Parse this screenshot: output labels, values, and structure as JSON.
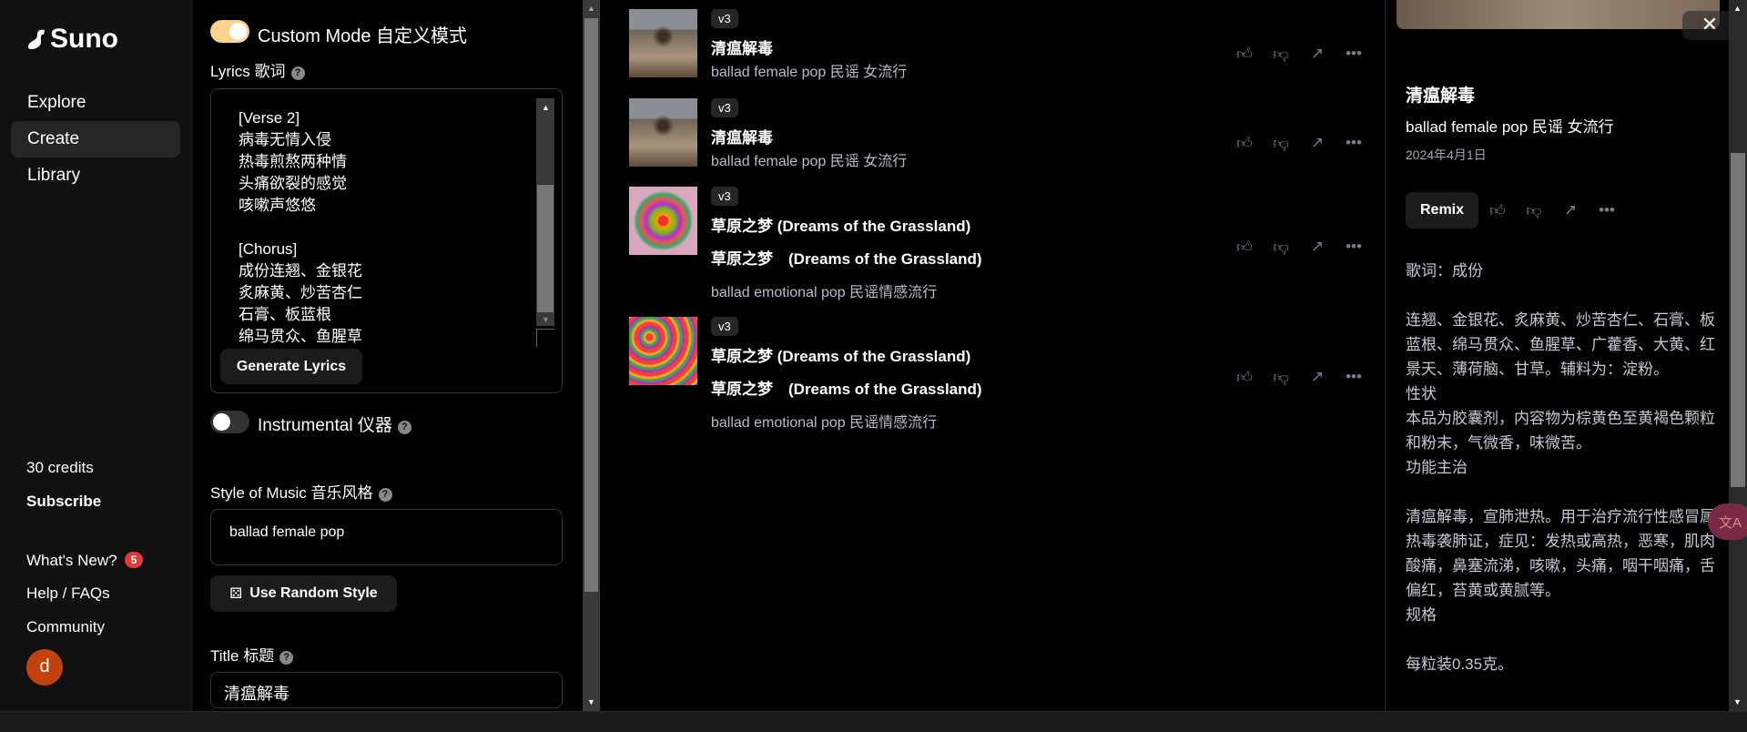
{
  "sidebar": {
    "logo": "Suno",
    "nav": [
      {
        "label": "Explore"
      },
      {
        "label": "Create",
        "active": true
      },
      {
        "label": "Library"
      }
    ],
    "credits": "30 credits",
    "subscribe": "Subscribe",
    "whats_new": "What's New?",
    "whats_new_badge": "5",
    "help": "Help / FAQs",
    "community": "Community",
    "avatar_letter": "d"
  },
  "create": {
    "custom_mode_label": "Custom Mode 自定义模式",
    "custom_mode_on": true,
    "lyrics_label": "Lyrics 歌词",
    "lyrics_lines": [
      "[Verse 2]",
      "病毒无情入侵",
      "热毒煎熬两种情",
      "头痛欲裂的感觉",
      "咳嗽声悠悠",
      "",
      "[Chorus]",
      "成份连翘、金银花",
      "炙麻黄、炒苦杏仁",
      "石膏、板蓝根",
      "绵马贯众、鱼腥草"
    ],
    "generate_lyrics": "Generate Lyrics",
    "instrumental_label": "Instrumental 仪器",
    "instrumental_on": false,
    "style_label": "Style of Music 音乐风格",
    "style_value": "ballad female pop",
    "random_style": "Use Random Style",
    "title_label": "Title 标题",
    "title_value": "清瘟解毒",
    "help_glyph": "?"
  },
  "songs": [
    {
      "version": "v3",
      "title": "清瘟解毒",
      "subtitle": "ballad female pop 民谣 女流行",
      "thumb": "desert-tree"
    },
    {
      "version": "v3",
      "title": "清瘟解毒",
      "subtitle": "ballad female pop 民谣 女流行",
      "thumb": "desert-tree"
    },
    {
      "version": "v3",
      "title": "草原之梦 (Dreams of the Grassland)",
      "title2": "草原之梦　(Dreams of the Grassland)",
      "subtitle": "ballad emotional pop 民谣情感流行",
      "thumb": "flower-ball"
    },
    {
      "version": "v3",
      "title": "草原之梦 (Dreams of the Grassland)",
      "title2": "草原之梦　(Dreams of the Grassland)",
      "subtitle": "ballad emotional pop 民谣情感流行",
      "thumb": "flower-field"
    }
  ],
  "detail": {
    "title": "清瘟解毒",
    "style": "ballad female pop 民谣 女流行",
    "date": "2024年4月1日",
    "remix": "Remix",
    "lyrics": "歌词：成份\n\n连翘、金银花、炙麻黄、炒苦杏仁、石膏、板蓝根、绵马贯众、鱼腥草、广藿香、大黄、红景天、薄荷脑、甘草。辅料为：淀粉。\n性状\n本品为胶囊剂，内容物为棕黄色至黄褐色颗粒和粉末，气微香，味微苦。\n功能主治\n\n清瘟解毒，宣肺泄热。用于治疗流行性感冒属热毒袭肺证，症见：发热或高热，恶寒，肌肉酸痛，鼻塞流涕，咳嗽，头痛，咽干咽痛，舌偏红，苔黄或黄腻等。\n规格\n\n每粒装0.35克。"
  },
  "icons": [
    "like-icon",
    "dislike-icon",
    "share-icon",
    "more-icon",
    "close-icon",
    "dice-icon",
    "translate-icon"
  ],
  "colors": {
    "toggle_on": "#fcd38d",
    "badge": "#e5383b",
    "avatar": "#c2410c"
  }
}
